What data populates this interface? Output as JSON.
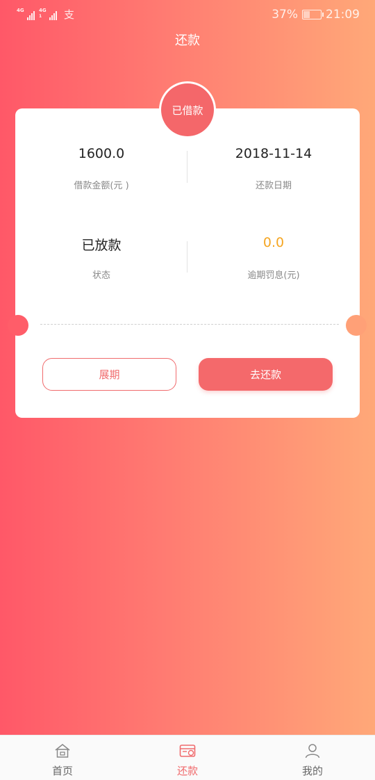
{
  "status_bar": {
    "sim1_label": "4G",
    "sim2_label": "4G",
    "sim2_sub": "1",
    "alipay_glyph": "支",
    "battery_percent": "37%",
    "battery_level": 0.37,
    "time": "21:09"
  },
  "header": {
    "title": "还款"
  },
  "loan": {
    "badge": "已借款",
    "amount_value": "1600.0",
    "amount_label": "借款金额(元 )",
    "date_value": "2018-11-14",
    "date_label": "还款日期",
    "status_value": "已放款",
    "status_label": "状态",
    "penalty_value": "0.0",
    "penalty_label": "逾期罚息(元)"
  },
  "actions": {
    "extend_label": "展期",
    "repay_label": "去还款"
  },
  "tabbar": {
    "items": [
      {
        "label": "首页",
        "icon": "home-icon"
      },
      {
        "label": "还款",
        "icon": "repay-card-icon",
        "active": true
      },
      {
        "label": "我的",
        "icon": "user-icon"
      }
    ]
  },
  "colors": {
    "accent": "#f4676a",
    "warn": "#f5a623",
    "gradient_start": "#ff5868",
    "gradient_end": "#ffa878"
  }
}
